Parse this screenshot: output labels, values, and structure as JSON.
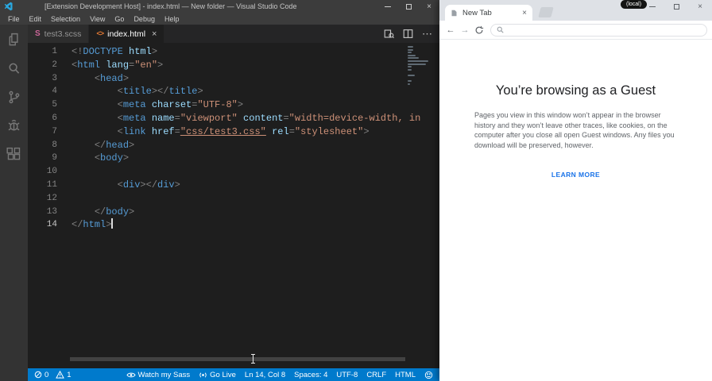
{
  "vscode": {
    "titlebar": {
      "title": "[Extension Development Host] - index.html — New folder — Visual Studio Code"
    },
    "menubar": [
      "File",
      "Edit",
      "Selection",
      "View",
      "Go",
      "Debug",
      "Help"
    ],
    "tabs": {
      "tab1": "test3.scss",
      "tab2": "index.html",
      "close": "×"
    },
    "editor_actions": {
      "more": "⋯"
    },
    "editor": {
      "lines": [
        {
          "num": 1,
          "tokens": [
            [
              "pn",
              "<!"
            ],
            [
              "tg",
              "DOCTYPE"
            ],
            [
              "at",
              " html"
            ],
            [
              "pn",
              ">"
            ]
          ]
        },
        {
          "num": 2,
          "tokens": [
            [
              "pn",
              "<"
            ],
            [
              "tg",
              "html"
            ],
            [
              "at",
              " lang"
            ],
            [
              "pn",
              "="
            ],
            [
              "st",
              "\"en\""
            ],
            [
              "pn",
              ">"
            ]
          ]
        },
        {
          "num": 3,
          "tokens": [
            [
              "pl",
              "    "
            ],
            [
              "pn",
              "<"
            ],
            [
              "tg",
              "head"
            ],
            [
              "pn",
              ">"
            ]
          ]
        },
        {
          "num": 4,
          "tokens": [
            [
              "pl",
              "        "
            ],
            [
              "pn",
              "<"
            ],
            [
              "tg",
              "title"
            ],
            [
              "pn",
              "></"
            ],
            [
              "tg",
              "title"
            ],
            [
              "pn",
              ">"
            ]
          ]
        },
        {
          "num": 5,
          "tokens": [
            [
              "pl",
              "        "
            ],
            [
              "pn",
              "<"
            ],
            [
              "tg",
              "meta"
            ],
            [
              "at",
              " charset"
            ],
            [
              "pn",
              "="
            ],
            [
              "st",
              "\"UTF-8\""
            ],
            [
              "pn",
              ">"
            ]
          ]
        },
        {
          "num": 6,
          "tokens": [
            [
              "pl",
              "        "
            ],
            [
              "pn",
              "<"
            ],
            [
              "tg",
              "meta"
            ],
            [
              "at",
              " name"
            ],
            [
              "pn",
              "="
            ],
            [
              "st",
              "\"viewport\""
            ],
            [
              "at",
              " content"
            ],
            [
              "pn",
              "="
            ],
            [
              "st",
              "\"width=device-width, in"
            ]
          ]
        },
        {
          "num": 7,
          "tokens": [
            [
              "pl",
              "        "
            ],
            [
              "pn",
              "<"
            ],
            [
              "tg",
              "link"
            ],
            [
              "at",
              " href"
            ],
            [
              "pn",
              "="
            ],
            [
              "stu",
              "\"css/test3.css\""
            ],
            [
              "at",
              " rel"
            ],
            [
              "pn",
              "="
            ],
            [
              "st",
              "\"stylesheet\""
            ],
            [
              "pn",
              ">"
            ]
          ]
        },
        {
          "num": 8,
          "tokens": [
            [
              "pl",
              "    "
            ],
            [
              "pn",
              "</"
            ],
            [
              "tg",
              "head"
            ],
            [
              "pn",
              ">"
            ]
          ]
        },
        {
          "num": 9,
          "tokens": [
            [
              "pl",
              "    "
            ],
            [
              "pn",
              "<"
            ],
            [
              "tg",
              "body"
            ],
            [
              "pn",
              ">"
            ]
          ]
        },
        {
          "num": 10,
          "tokens": []
        },
        {
          "num": 11,
          "tokens": [
            [
              "pl",
              "        "
            ],
            [
              "pn",
              "<"
            ],
            [
              "tg",
              "div"
            ],
            [
              "pn",
              "></"
            ],
            [
              "tg",
              "div"
            ],
            [
              "pn",
              ">"
            ]
          ]
        },
        {
          "num": 12,
          "tokens": []
        },
        {
          "num": 13,
          "tokens": [
            [
              "pl",
              "    "
            ],
            [
              "pn",
              "</"
            ],
            [
              "tg",
              "body"
            ],
            [
              "pn",
              ">"
            ]
          ]
        },
        {
          "num": 14,
          "tokens": [
            [
              "pn",
              "</"
            ],
            [
              "tg",
              "html"
            ],
            [
              "pn",
              ">"
            ]
          ],
          "cursor": true
        }
      ]
    },
    "statusbar": {
      "errors": "0",
      "warnings": "1",
      "watch_sass": "Watch my Sass",
      "go_live": "Go Live",
      "cursor": "Ln 14, Col 8",
      "spaces": "Spaces: 4",
      "encoding": "UTF-8",
      "eol": "CRLF",
      "language": "HTML"
    }
  },
  "browser": {
    "badge": "(local)",
    "tab": {
      "title": "New Tab",
      "close": "×"
    },
    "nav": {
      "back": "←",
      "forward": "→"
    },
    "content": {
      "heading": "You’re browsing as a Guest",
      "body": "Pages you view in this window won’t appear in the browser history and they won’t leave other traces, like cookies, on the computer after you close all open Guest windows. Any files you download will be preserved, however.",
      "link": "LEARN MORE"
    }
  },
  "colors": {
    "vscode_statusbar": "#007acc",
    "vscode_bg": "#1e1e1e",
    "browser_link": "#1a73e8",
    "tag_blue": "#569cd6",
    "string_orange": "#ce9178"
  }
}
